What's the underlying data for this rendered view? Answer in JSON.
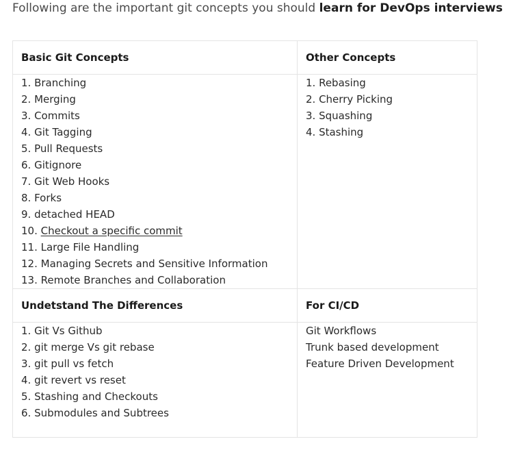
{
  "intro": {
    "prefix": "Following are the important git concepts you should ",
    "bold": "learn for DevOps interviews"
  },
  "table": {
    "headers_top": {
      "left": "Basic Git Concepts",
      "right": "Other Concepts"
    },
    "basic_concepts": [
      "1. Branching",
      "2. Merging",
      "3. Commits",
      "4. Git Tagging",
      "5. Pull Requests",
      "6. Gitignore",
      "7. Git Web Hooks",
      "8. Forks",
      "9. detached HEAD"
    ],
    "basic_link_item": {
      "prefix": "10. ",
      "link_text": "Checkout a specific commit"
    },
    "basic_concepts_tail": [
      "11. Large File Handling",
      "12. Managing Secrets and Sensitive Information",
      "13. Remote Branches and Collaboration"
    ],
    "other_concepts": [
      "1. Rebasing",
      "2. Cherry Picking",
      "3. Squashing",
      "4. Stashing"
    ],
    "headers_bottom": {
      "left": "Undetstand The Differences",
      "right": "For CI/CD"
    },
    "differences": [
      "1. Git Vs Github",
      "2. git merge Vs git rebase",
      "3. git pull vs fetch",
      "4. git revert vs reset",
      "5. Stashing and Checkouts",
      "6. Submodules and Subtrees"
    ],
    "cicd": [
      "Git Workflows",
      "Trunk based development",
      "Feature Driven Development"
    ]
  }
}
